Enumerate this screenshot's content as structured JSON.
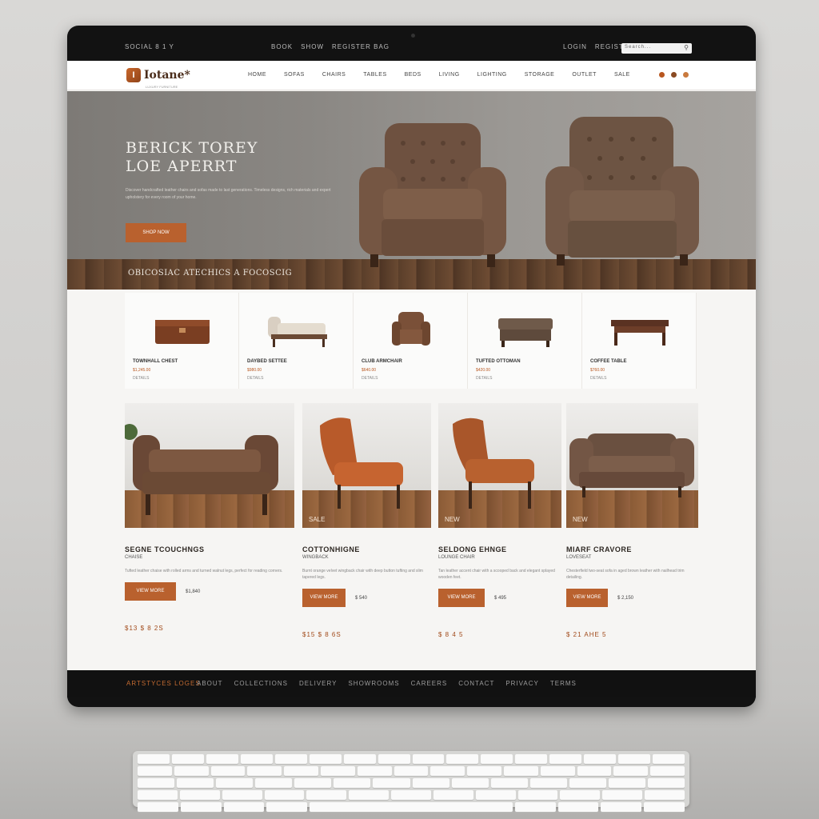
{
  "topbar": {
    "left": "SOCIAL 8 1 Y",
    "links": [
      "BOOK",
      "SHOW",
      "REGISTER BAG"
    ],
    "right": [
      "LOGIN",
      "REGISTER"
    ],
    "search_placeholder": "Search..."
  },
  "nav": {
    "logo_text": "Iotane*",
    "logo_mark": "I",
    "tagline": "LUXURY FURNITURE",
    "menu": [
      "HOME",
      "SOFAS",
      "CHAIRS",
      "TABLES",
      "BEDS",
      "LIVING",
      "LIGHTING",
      "STORAGE",
      "OUTLET",
      "SALE"
    ],
    "icon_colors": [
      "#b8561f",
      "#8a4a22",
      "#c97a3e"
    ]
  },
  "hero": {
    "title_line1": "BERICK TOREY",
    "title_line2": "LOE APERRT",
    "copy": "Discover handcrafted leather chairs and sofas made to last generations. Timeless designs, rich materials and expert upholstery for every room of your home.",
    "button": "SHOP NOW",
    "caption": "OBICOSIAC ATECHICS A FOCOSCIG"
  },
  "categories": [
    {
      "name": "TOWNHALL CHEST",
      "line": "$1,245.00",
      "price": "DETAILS",
      "icon": "chest-icon"
    },
    {
      "name": "DAYBED SETTEE",
      "line": "$980.00",
      "price": "DETAILS",
      "icon": "daybed-icon"
    },
    {
      "name": "CLUB ARMCHAIR",
      "line": "$640.00",
      "price": "DETAILS",
      "icon": "armchair-icon"
    },
    {
      "name": "TUFTED OTTOMAN",
      "line": "$420.00",
      "price": "DETAILS",
      "icon": "ottoman-icon"
    },
    {
      "name": "COFFEE TABLE",
      "line": "$760.00",
      "price": "DETAILS",
      "icon": "table-icon"
    }
  ],
  "products": [
    {
      "title": "SEGNE TCOUCHNGS",
      "sub": "CHAISE",
      "desc": "Tufted leather chaise with rolled arms and turned walnut legs, perfect for reading corners.",
      "button": "VIEW MORE",
      "price": "$1,840",
      "foot": "$13 $ 8 2S",
      "badge": ""
    },
    {
      "title": "COTTONHIGNE",
      "sub": "WINGBACK",
      "desc": "Burnt orange velvet wingback chair with deep button tufting and slim tapered legs.",
      "button": "VIEW MORE",
      "price": "$ 540",
      "foot": "$15 $ 8 6S",
      "badge": "SALE"
    },
    {
      "title": "SELDONG EHNGE",
      "sub": "LOUNGE CHAIR",
      "desc": "Tan leather accent chair with a scooped back and elegant splayed wooden feet.",
      "button": "VIEW MORE",
      "price": "$ 495",
      "foot": "$ 8 4 5",
      "badge": "NEW"
    },
    {
      "title": "MIARF CRAVORE",
      "sub": "LOVESEAT",
      "desc": "Chesterfield two-seat sofa in aged brown leather with nailhead trim detailing.",
      "button": "VIEW MORE",
      "price": "$ 2,150",
      "foot": "$ 21 AHE 5",
      "badge": "NEW"
    }
  ],
  "footer": {
    "accent": "ARTSTYCES LOGES",
    "links": [
      "ABOUT",
      "COLLECTIONS",
      "DELIVERY",
      "SHOWROOMS",
      "CAREERS",
      "CONTACT",
      "PRIVACY",
      "TERMS"
    ]
  },
  "colors": {
    "accent": "#b9612e",
    "leather": "#6b4a35",
    "dark": "#121212"
  }
}
